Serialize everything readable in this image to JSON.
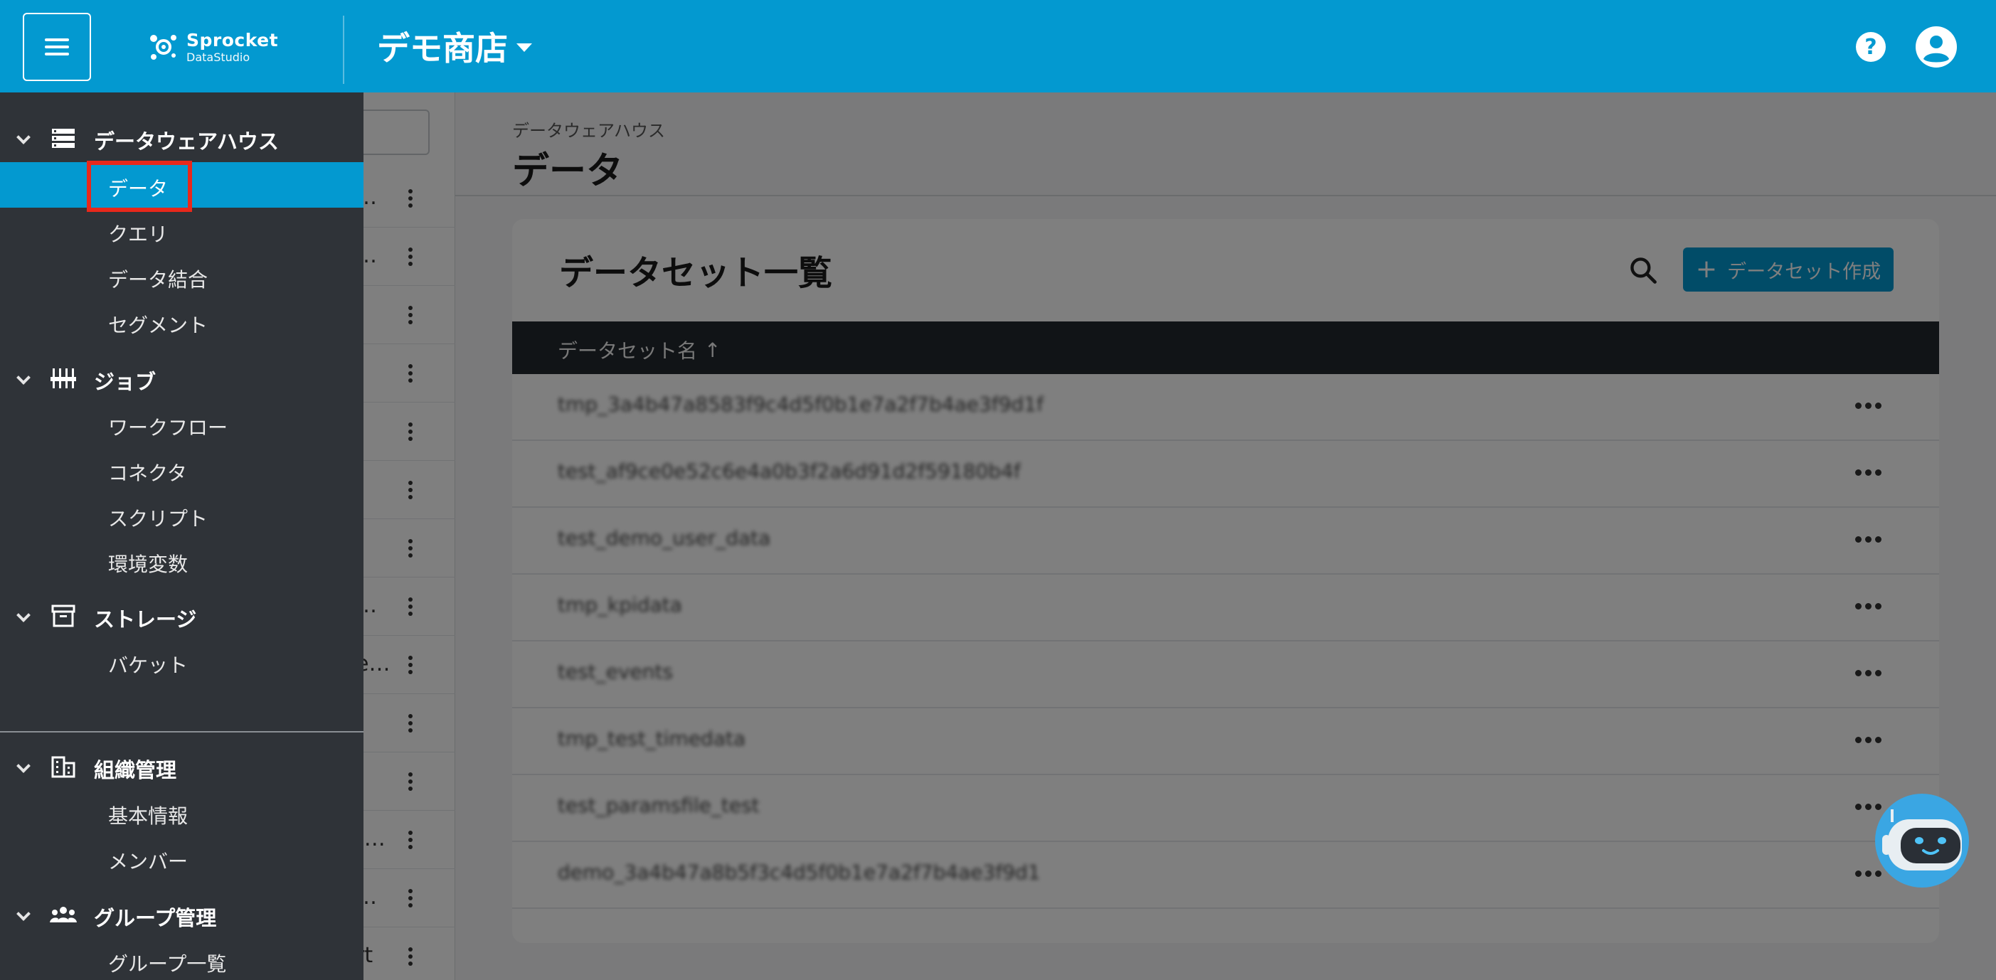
{
  "header": {
    "brand_name": "Sprocket",
    "brand_sub": "DataStudio",
    "shop_name": "デモ商店"
  },
  "middle_list": {
    "tails": [
      "…",
      "…",
      "",
      "",
      "",
      "",
      "",
      "…",
      "e…",
      "",
      "",
      ")…",
      "…",
      "rt"
    ]
  },
  "content": {
    "breadcrumb": "データウェアハウス",
    "title": "データ",
    "card": {
      "title": "データセット一覧",
      "create_button": "データセット作成",
      "column_header": "データセット名",
      "sort_arrow": "↑",
      "rows": [
        "tmp_3a4b47a8583f9c4d5f0b1e7a2f7b4ae3f9d1f",
        "test_af9ce0e52c6e4a0b3f2a6d91d2f59180b4f",
        "test_demo_user_data",
        "tmp_kpidata",
        "test_events",
        "tmp_test_timedata",
        "test_paramsfile_test",
        "demo_3a4b47a8b5f3c4d5f0b1e7a2f7b4ae3f9d1"
      ]
    }
  },
  "sidebar": {
    "sections": [
      {
        "label": "データウェアハウス",
        "icon": "storage-icon",
        "items": [
          "データ",
          "クエリ",
          "データ結合",
          "セグメント"
        ]
      },
      {
        "label": "ジョブ",
        "icon": "jobs-icon",
        "items": [
          "ワークフロー",
          "コネクタ",
          "スクリプト",
          "環境変数"
        ]
      },
      {
        "label": "ストレージ",
        "icon": "archive-box-icon",
        "items": [
          "バケット"
        ]
      },
      {
        "label": "組織管理",
        "icon": "building-icon",
        "items": [
          "基本情報",
          "メンバー"
        ]
      },
      {
        "label": "グループ管理",
        "icon": "group-icon",
        "items": [
          "グループ一覧"
        ]
      }
    ],
    "active_item": "データ"
  },
  "colors": {
    "primary": "#0399d0",
    "sidebar_bg": "#2f3338",
    "highlight": "#e8281b",
    "table_header": "#23292e"
  }
}
